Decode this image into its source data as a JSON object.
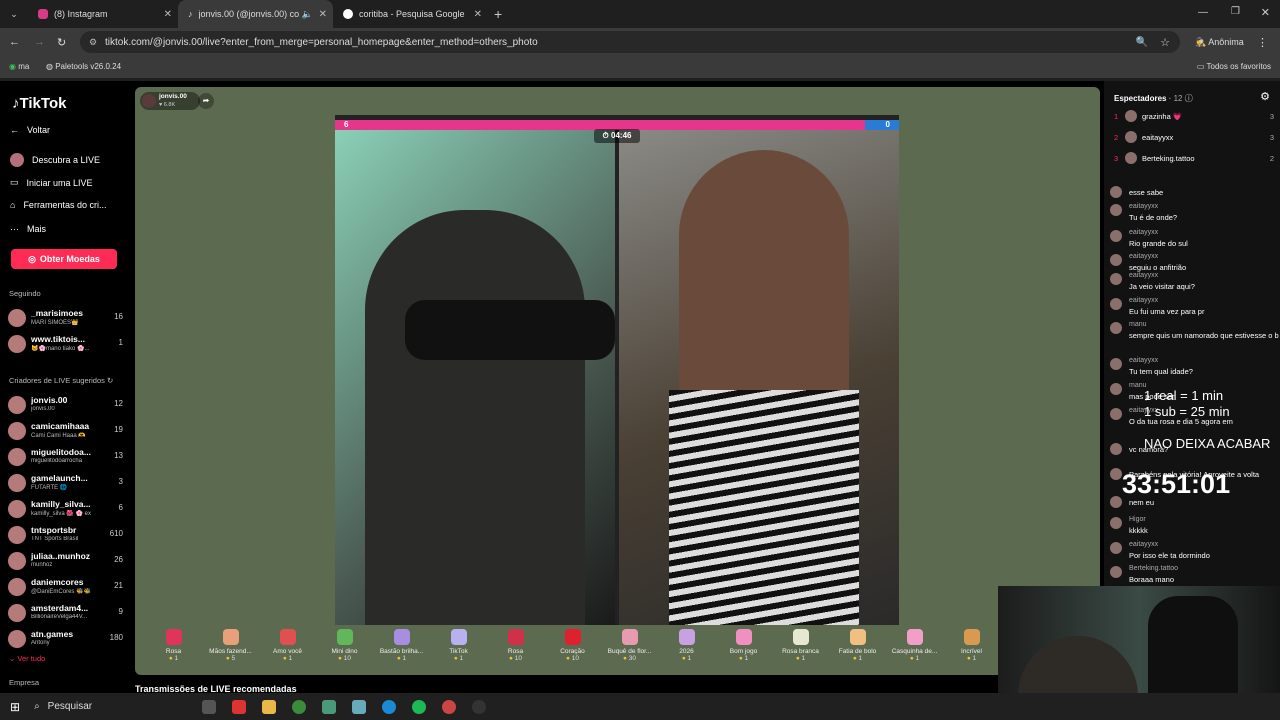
{
  "browser": {
    "tabs": [
      {
        "label": "(8) Instagram",
        "active": false
      },
      {
        "label": "jonvis.00 (@jonvis.00) com",
        "active": true
      },
      {
        "label": "coritiba - Pesquisa Google",
        "active": false
      }
    ],
    "url": "tiktok.com/@jonvis.00/live?enter_from_merge=personal_homepage&enter_method=others_photo",
    "profile": "Anônima",
    "bookmarks": [
      {
        "label": "ma"
      },
      {
        "label": "Paletools v26.0.24"
      }
    ],
    "all_favorites": "Todos os favoritos"
  },
  "sidebar": {
    "logo": "TikTok",
    "back": "Voltar",
    "nav": [
      "Descubra a LIVE",
      "Iniciar uma LIVE",
      "Ferramentas do cri...",
      "Mais"
    ],
    "coins_button": "Obter Moedas",
    "following_title": "Seguindo",
    "following": [
      {
        "name": "_marisimoes",
        "sub": "MARI SIMÕES👑",
        "count": "16"
      },
      {
        "name": "www.tiktois...",
        "sub": "🐱🌸mano tiako 🌸...",
        "count": "1"
      }
    ],
    "suggested_title": "Criadores de LIVE sugeridos",
    "suggested": [
      {
        "name": "jonvis.00",
        "sub": "jonvis.00",
        "count": "12"
      },
      {
        "name": "camicamihaaa",
        "sub": "Cami Cami Haaa 🫶",
        "count": "19"
      },
      {
        "name": "miguelitodoa...",
        "sub": "miguelitodoarrocha",
        "count": "13"
      },
      {
        "name": "gamelaunch...",
        "sub": "FUTARTE 🌐",
        "count": "3"
      },
      {
        "name": "kamilly_silva...",
        "sub": "kamilly_silva 🌺 🌸 ex",
        "count": "6"
      },
      {
        "name": "tntsportsbr",
        "sub": "TNT Sports Brasil",
        "count": "610"
      },
      {
        "name": "juliaa..munhoz",
        "sub": "munhoz",
        "count": "26"
      },
      {
        "name": "daniemcores",
        "sub": "@DaniEmCores 🐝🐝",
        "count": "21"
      },
      {
        "name": "amsterdam4...",
        "sub": "BillionaireVelga44V...",
        "count": "9"
      },
      {
        "name": "atn.games",
        "sub": "Antony",
        "count": "180"
      }
    ],
    "see_all": "Ver tudo",
    "company": "Empresa"
  },
  "stream": {
    "host": "jonvis.00",
    "likes": "6.8K",
    "score_left": "6",
    "score_right": "0",
    "timer": "04:46",
    "recommended": "Transmissões de LIVE recomendadas"
  },
  "gifts": [
    {
      "name": "Rosa",
      "price": "1",
      "color": "#e0345a"
    },
    {
      "name": "Mãos fazend...",
      "price": "5",
      "color": "#e7a07a"
    },
    {
      "name": "Amo você",
      "price": "1",
      "color": "#e05050"
    },
    {
      "name": "Mini dino",
      "price": "10",
      "color": "#5fb85a"
    },
    {
      "name": "Bastão brilha...",
      "price": "1",
      "color": "#a78ee0"
    },
    {
      "name": "TikTok",
      "price": "1",
      "color": "#b9b0f0"
    },
    {
      "name": "Rosa",
      "price": "10",
      "color": "#d0304a"
    },
    {
      "name": "Coração",
      "price": "10",
      "color": "#e02030"
    },
    {
      "name": "Buquê de flor...",
      "price": "30",
      "color": "#e89ab0"
    },
    {
      "name": "2026",
      "price": "1",
      "color": "#c9a0e0"
    },
    {
      "name": "Bom jogo",
      "price": "1",
      "color": "#f090c0"
    },
    {
      "name": "Rosa branca",
      "price": "1",
      "color": "#e8e8d0"
    },
    {
      "name": "Fatia de bolo",
      "price": "1",
      "color": "#f0c080"
    },
    {
      "name": "Casquinha de...",
      "price": "1",
      "color": "#f0a0c8"
    },
    {
      "name": "Incrível",
      "price": "1",
      "color": "#d89a50"
    }
  ],
  "viewers": {
    "title": "Espectadores",
    "count": "12",
    "list": [
      {
        "rank": "1",
        "name": "grazinha 💗",
        "score": "3"
      },
      {
        "rank": "2",
        "name": "eaitayyxx",
        "score": "3"
      },
      {
        "rank": "3",
        "name": "Berteking.tattoo",
        "score": "2"
      }
    ]
  },
  "comments": [
    {
      "user": "",
      "text": "esse sabe"
    },
    {
      "user": "eaitayyxx",
      "text": "Tu é de onde?"
    },
    {
      "user": "eaitayyxx",
      "text": "Rio grande do sul"
    },
    {
      "user": "eaitayyxx",
      "text": "seguiu o anfitrião"
    },
    {
      "user": "eaitayyxx",
      "text": "Ja veio visitar aqui?"
    },
    {
      "user": "eaitayyxx",
      "text": "Eu fui uma vez para pr"
    },
    {
      "user": "manu",
      "text": "sempre quis um namorado que estivesse o braço tatuado"
    },
    {
      "user": "eaitayyxx",
      "text": "Tu tem qual idade?"
    },
    {
      "user": "manu",
      "text": "mas pode ser"
    },
    {
      "user": "eaitayyxx",
      "text": "O da tua rosa e dia 5 agora em"
    },
    {
      "user": "",
      "text": "vc namora?"
    },
    {
      "user": "",
      "text": "Parabéns pela vitória! Aproveite a volta"
    },
    {
      "user": "",
      "text": "nem eu"
    },
    {
      "user": "Higor",
      "text": "kkkkk"
    },
    {
      "user": "eaitayyxx",
      "text": "Por isso ele ta dormindo"
    },
    {
      "user": "Berteking.tattoo",
      "text": "Boraaa mano"
    }
  ],
  "overlay": {
    "line1": "1 real = 1 min",
    "line2": "1 sub = 25 min",
    "line3": "NAO DEIXA ACABAR",
    "timer": "33:51:01"
  },
  "taskbar": {
    "search": "Pesquisar"
  }
}
